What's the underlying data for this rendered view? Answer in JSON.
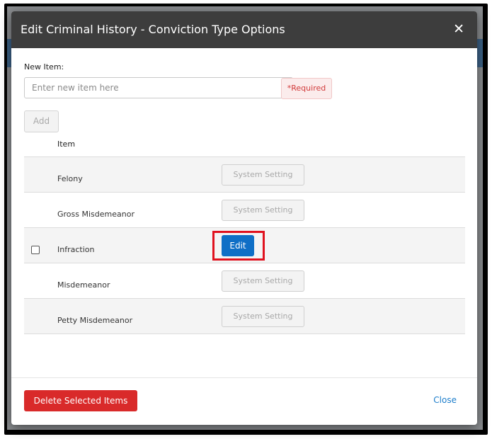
{
  "modal": {
    "title": "Edit Criminal History - Conviction Type Options",
    "close_icon": "close-icon"
  },
  "new_item": {
    "label": "New Item:",
    "placeholder": "Enter new item here",
    "required_text": "*Required",
    "add_label": "Add"
  },
  "table": {
    "column_header": "Item",
    "rows": [
      {
        "name": "Felony",
        "action": "System Setting",
        "selectable": false
      },
      {
        "name": "Gross Misdemeanor",
        "action": "System Setting",
        "selectable": false
      },
      {
        "name": "Infraction",
        "action": "Edit",
        "selectable": true
      },
      {
        "name": "Misdemeanor",
        "action": "System Setting",
        "selectable": false
      },
      {
        "name": "Petty Misdemeanor",
        "action": "System Setting",
        "selectable": false
      }
    ]
  },
  "footer": {
    "delete_label": "Delete Selected Items",
    "close_label": "Close"
  },
  "colors": {
    "header_bg": "#3d3d3d",
    "edit_button": "#0f6fc6",
    "delete_button": "#d92a2a",
    "highlight_box": "#e0121f",
    "close_link": "#1c7dcb"
  }
}
